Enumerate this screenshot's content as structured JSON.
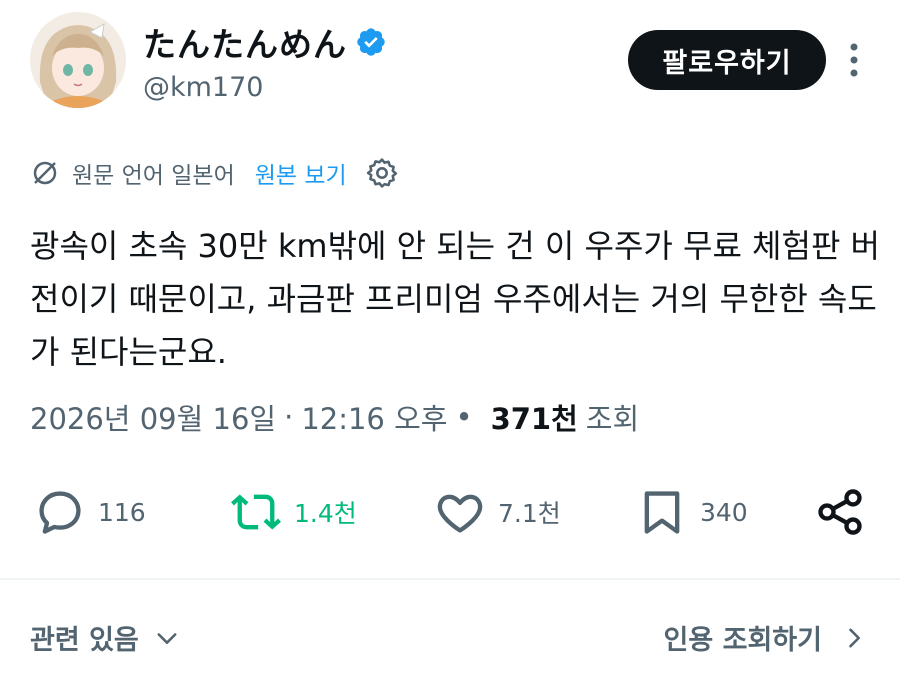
{
  "profile": {
    "display_name": "たんたんめん",
    "handle": "@km170",
    "follow_label": "팔로우하기"
  },
  "translation": {
    "source_language_text": "원문 언어 일본어",
    "show_original_label": "원본 보기"
  },
  "tweet": {
    "text": "광속이 초속 30만 km밖에 안 되는 건 이 우주가 무료 체험판 버전이기 때문이고, 과금판 프리미엄 우주에서는 거의 무한한 속도가 된다는군요.",
    "date": "2026년 09월 16일",
    "time": "12:16 오후",
    "views_count": "371천",
    "views_label": "조회"
  },
  "actions": {
    "replies": "116",
    "retweets": "1.4천",
    "likes": "7.1천",
    "bookmarks": "340"
  },
  "footer": {
    "related_label": "관련 있음",
    "quotes_label": "인용 조회하기"
  },
  "colors": {
    "accent": "#1d9bf0",
    "retweet_green": "#00ba7c",
    "text": "#0f1419",
    "muted": "#536471"
  },
  "icons": [
    "verified-badge-icon",
    "more-icon",
    "translate-icon",
    "gear-icon",
    "reply-icon",
    "retweet-icon",
    "like-icon",
    "bookmark-icon",
    "share-icon",
    "chevron-down-icon",
    "chevron-right-icon"
  ]
}
